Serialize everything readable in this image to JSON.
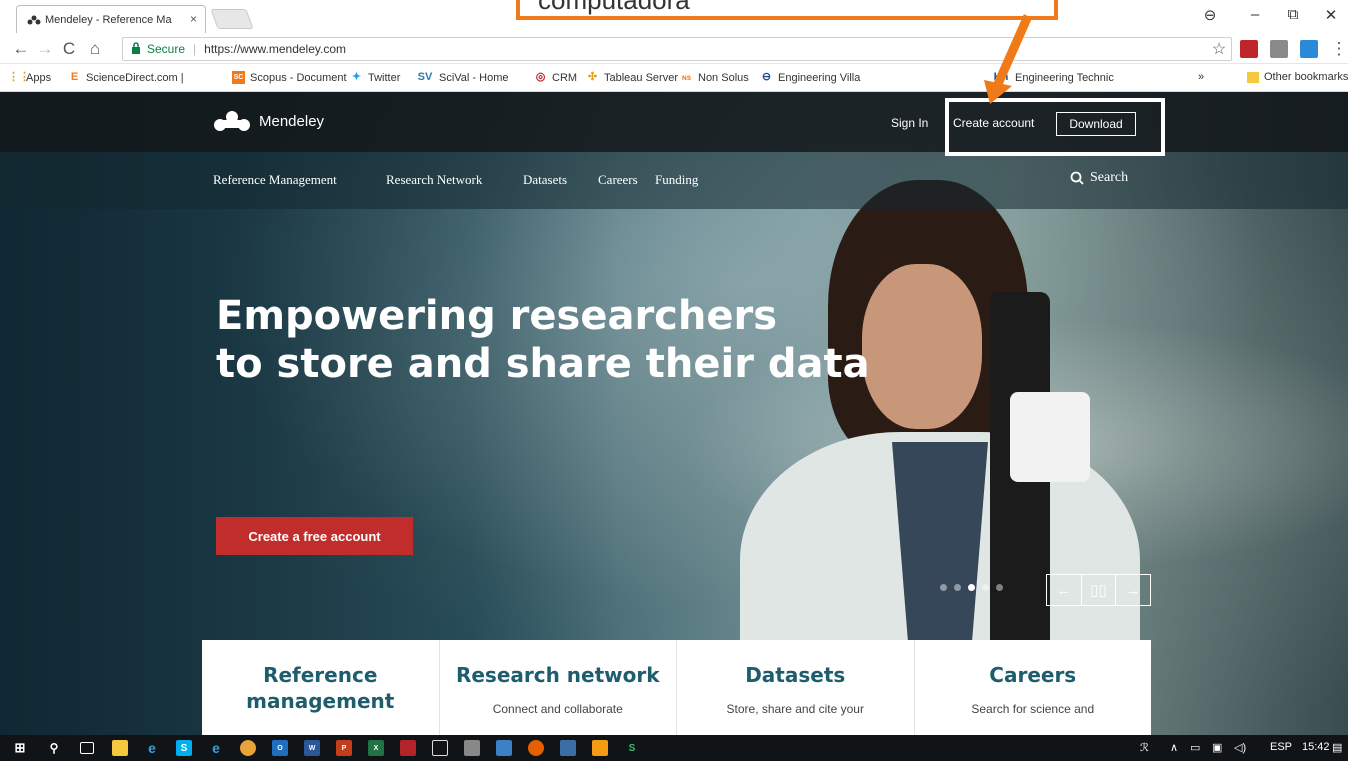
{
  "browser": {
    "tab_title": "Mendeley - Reference Ma",
    "tab_close": "×",
    "url_secure_label": "Secure",
    "url": "https://www.mendeley.com",
    "window_controls": {
      "account": "⊖",
      "minimize": "–",
      "maximize": "⧉",
      "close": "✕"
    },
    "nav": {
      "back": "←",
      "forward": "→",
      "reload": "C",
      "home": "⌂"
    },
    "star": "☆",
    "menu": "⋮"
  },
  "bookmarks": {
    "items": [
      {
        "label": "Apps",
        "icon": "apps-grid-icon",
        "color": "#e6a11b"
      },
      {
        "label": "ScienceDirect.com |",
        "icon": "sciencedirect-icon",
        "color": "#f07a1a"
      },
      {
        "label": "Scopus - Document",
        "icon": "scopus-icon",
        "color": "#f07a1a"
      },
      {
        "label": "Twitter",
        "icon": "twitter-icon",
        "color": "#1da1f2"
      },
      {
        "label": "SciVal - Home",
        "icon": "scival-icon",
        "color": "#2a7ab0"
      },
      {
        "label": "CRM",
        "icon": "crm-icon",
        "color": "#c0252a"
      },
      {
        "label": "Tableau Server",
        "icon": "tableau-icon",
        "color": "#e6a11b"
      },
      {
        "label": "Non Solus",
        "icon": "nonsolus-icon",
        "color": "#f07a1a"
      },
      {
        "label": "Engineering Villa",
        "icon": "engineering-village-icon",
        "color": "#1e4f8f"
      },
      {
        "label": "Engineering Technic",
        "icon": "knovel-icon",
        "color": "#1e4f8f"
      }
    ],
    "overflow": "»",
    "other": "Other bookmarks"
  },
  "site": {
    "brand": "Mendeley",
    "sign_in": "Sign In",
    "create_account": "Create account",
    "download": "Download",
    "nav": [
      "Reference Management",
      "Research Network",
      "Datasets",
      "Careers",
      "Funding"
    ],
    "search": "Search",
    "hero_line1": "Empowering researchers",
    "hero_line2": "to store and share their data",
    "cta": "Create a free account",
    "carousel": {
      "prev": "←",
      "pause": "▯▯",
      "next": "→",
      "slides": 5,
      "active_slide": 3
    },
    "cards": [
      {
        "title": "Reference management",
        "desc": ""
      },
      {
        "title": "Research network",
        "desc": "Connect and collaborate"
      },
      {
        "title": "Datasets",
        "desc": "Store, share and cite your"
      },
      {
        "title": "Careers",
        "desc": "Search for science and"
      }
    ]
  },
  "annotation": {
    "callout_text": "computadora",
    "callout_color": "#f07a1a"
  },
  "taskbar": {
    "language": "ESP",
    "time": "15:42"
  }
}
